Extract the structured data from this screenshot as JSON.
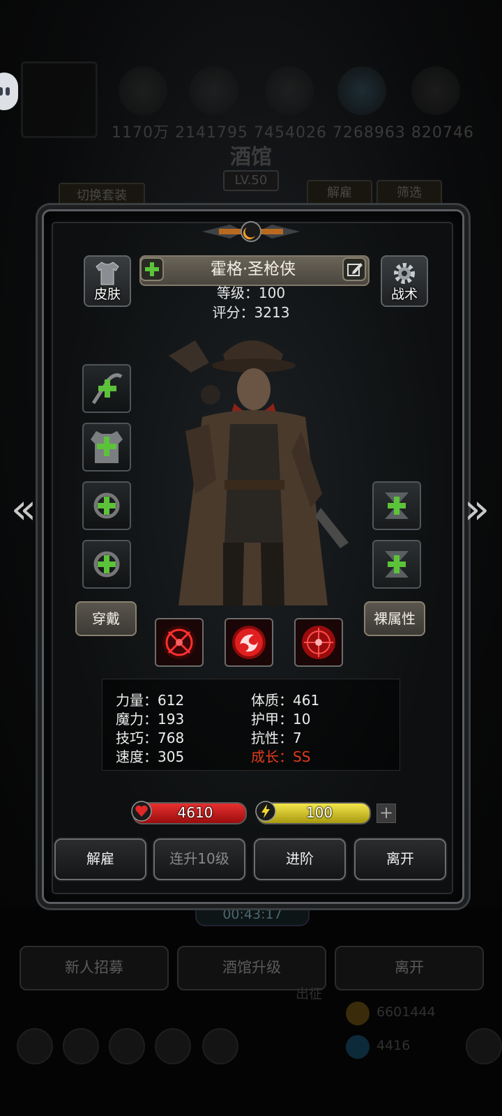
{
  "background": {
    "number_strip": "1170万 2141795 7454026 7268963 820746",
    "title": "酒馆",
    "level": "LV.50",
    "switch_outfit": "切换套装",
    "dismiss": "解雇",
    "filter": "筛选",
    "timer": "00:43:17",
    "recruit": "新人招募",
    "upgrade_tavern": "酒馆升级",
    "leave": "离开",
    "expedition": "出征",
    "gold": "6601444",
    "gems": "4416"
  },
  "hero": {
    "name": "霍格·圣枪侠",
    "level_label": "等级：100",
    "score_label": "评分：3213",
    "skin_label": "皮肤",
    "tactics_label": "战术",
    "equip_label": "穿戴",
    "base_attr_label": "裸属性"
  },
  "stats": [
    {
      "label": "力量：612"
    },
    {
      "label": "体质：461"
    },
    {
      "label": "魔力：193"
    },
    {
      "label": "护甲：10"
    },
    {
      "label": "技巧：768"
    },
    {
      "label": "抗性：7"
    },
    {
      "label": "速度：305"
    },
    {
      "label": "成长：SS"
    }
  ],
  "bars": {
    "hp": "4610",
    "energy": "100"
  },
  "actions": {
    "dismiss": "解雇",
    "level_up_10": "连升10级",
    "advance": "进阶",
    "leave": "离开"
  },
  "nav": {
    "prev": "«",
    "next": "»"
  },
  "colors": {
    "accent_red": "#e23a1e",
    "hp": "#d42020",
    "energy": "#e6d634",
    "plus_green": "#5cc23a"
  }
}
